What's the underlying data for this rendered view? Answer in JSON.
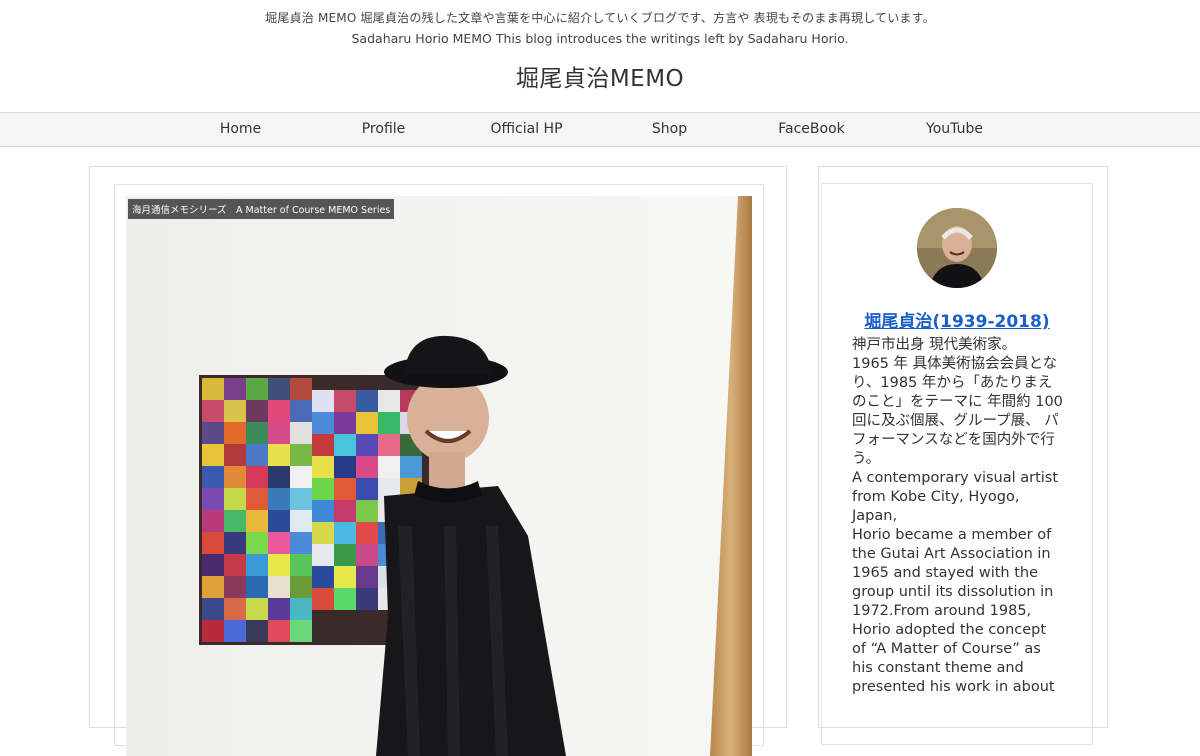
{
  "header": {
    "tagline_ja": "堀尾貞治 MEMO 堀尾貞治の残した文章や言葉を中心に紹介していくブログです、方言や 表現もそのまま再現しています。",
    "tagline_en": "Sadaharu Horio MEMO This blog introduces the writings left by Sadaharu Horio.",
    "site_title": "堀尾貞治MEMO"
  },
  "nav": {
    "items": [
      {
        "label": "Home"
      },
      {
        "label": "Profile"
      },
      {
        "label": "Official HP"
      },
      {
        "label": "Shop"
      },
      {
        "label": "FaceBook"
      },
      {
        "label": "YouTube"
      }
    ]
  },
  "post": {
    "category_tag": "海月通信メモシリーズ　A Matter of Course MEMO Series"
  },
  "sidebar": {
    "profile": {
      "name": "堀尾貞治(1939-2018)",
      "desc_lines": [
        "神戸市出身 現代美術家。",
        "1965 年 具体美術協会会員となり、1985 年から「あたりまえのこと」をテーマに 年間約 100 回に及ぶ個展、グループ展、 パフォーマンスなどを国内外で行う。",
        "A contemporary visual artist from Kobe City, Hyogo, Japan,",
        "Horio became a member of the Gutai Art Association in 1965 and stayed with the group until its dissolution in 1972.From around 1985, Horio adopted the concept of “A Matter of Course” as his constant theme and presented his work in about"
      ]
    }
  },
  "colors": {
    "link": "#1a5ec9",
    "nav_bg": "#f6f6f6",
    "tag_bg": "#555555"
  }
}
